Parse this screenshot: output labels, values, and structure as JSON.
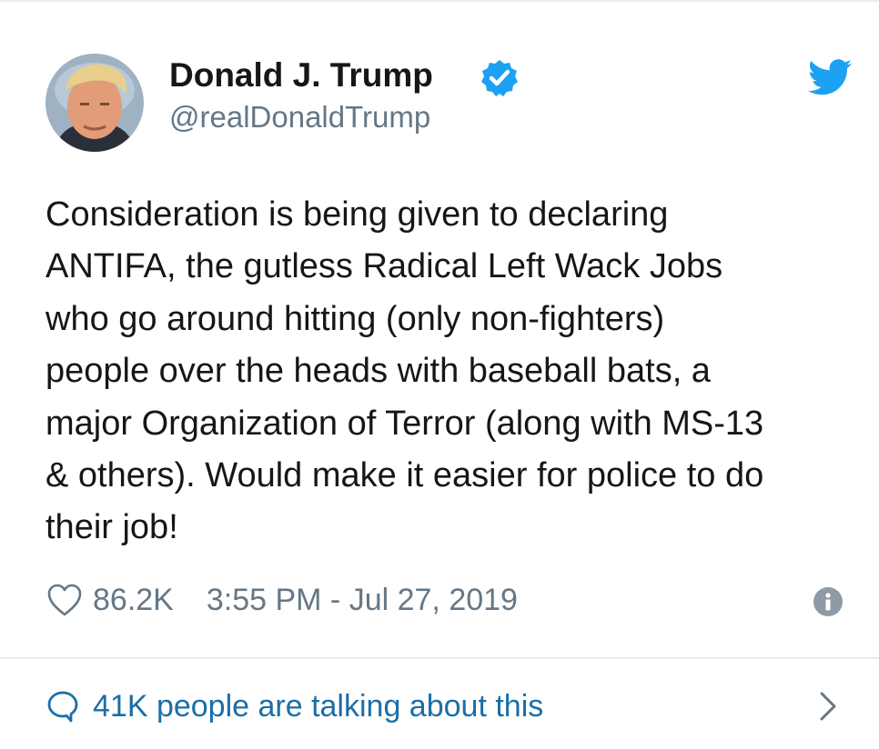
{
  "tweet": {
    "author_name": "Donald J. Trump",
    "handle": "@realDonaldTrump",
    "verified": true,
    "text": "Consideration is being given to declaring\nANTIFA, the gutless Radical Left Wack Jobs\nwho go around hitting (only non-fighters)\npeople over the heads with baseball bats, a\nmajor Organization of Terror (along with MS-13\n& others). Would make it easier for police to do\ntheir job!",
    "likes": "86.2K",
    "timestamp": "3:55 PM - Jul 27, 2019"
  },
  "footer": {
    "talking_label": "41K people are talking about this"
  },
  "icons": {
    "avatar": "profile-photo",
    "verified": "verified-badge-icon",
    "brand": "twitter-bird-icon",
    "like": "heart-icon",
    "info": "info-icon",
    "reply": "speech-bubble-icon",
    "chevron": "chevron-right-icon"
  },
  "colors": {
    "brand_blue": "#1da1f2",
    "text": "#14171a",
    "secondary": "#657786",
    "link": "#1b6ea8",
    "divider": "#e6ecf0"
  }
}
